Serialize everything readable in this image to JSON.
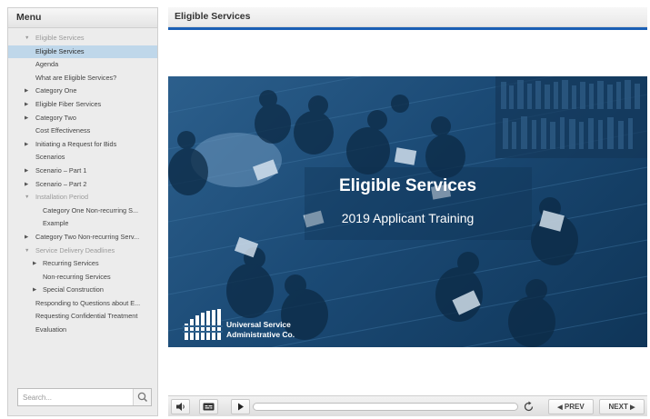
{
  "menu": {
    "header": "Menu",
    "items": [
      {
        "label": "Eligible Services",
        "indent": 1,
        "arrow": "down",
        "dim": true
      },
      {
        "label": "Eligible Services",
        "indent": 2,
        "selected": true
      },
      {
        "label": "Agenda",
        "indent": 2
      },
      {
        "label": "What are Eligible Services?",
        "indent": 2
      },
      {
        "label": "Category One",
        "indent": 1,
        "arrow": "right"
      },
      {
        "label": "Eligible Fiber Services",
        "indent": 1,
        "arrow": "right"
      },
      {
        "label": "Category Two",
        "indent": 1,
        "arrow": "right"
      },
      {
        "label": "Cost Effectiveness",
        "indent": 2
      },
      {
        "label": "Initiating a Request for Bids",
        "indent": 1,
        "arrow": "right"
      },
      {
        "label": "Scenarios",
        "indent": 2
      },
      {
        "label": "Scenario – Part 1",
        "indent": 1,
        "arrow": "right"
      },
      {
        "label": "Scenario – Part 2",
        "indent": 1,
        "arrow": "right"
      },
      {
        "label": "Installation Period",
        "indent": 1,
        "arrow": "down",
        "dim": true
      },
      {
        "label": "Category One Non-recurring S...",
        "indent": 3
      },
      {
        "label": "Example",
        "indent": 3
      },
      {
        "label": "Category Two Non-recurring Serv...",
        "indent": 1,
        "arrow": "right"
      },
      {
        "label": "Service Delivery Deadlines",
        "indent": 1,
        "arrow": "down",
        "dim": true
      },
      {
        "label": "Recurring Services",
        "indent": 3,
        "arrow": "right"
      },
      {
        "label": "Non-recurring Services",
        "indent": 3
      },
      {
        "label": "Special Construction",
        "indent": 3,
        "arrow": "right"
      },
      {
        "label": "Responding to Questions about E...",
        "indent": 2
      },
      {
        "label": "Requesting Confidential Treatment",
        "indent": 2
      },
      {
        "label": "Evaluation",
        "indent": 2
      }
    ]
  },
  "search": {
    "placeholder": "Search..."
  },
  "player": {
    "title": "Eligible Services",
    "slide": {
      "title": "Eligible Services",
      "subtitle": "2019 Applicant Training",
      "brand_line1": "Universal Service",
      "brand_line2": "Administrative Co."
    }
  },
  "controls": {
    "prev_label": "PREV",
    "next_label": "NEXT"
  },
  "icons": [
    "volume-icon",
    "captions-icon",
    "play-icon",
    "replay-icon",
    "search-icon",
    "chevron-left-icon",
    "chevron-right-icon",
    "menu-expanded-icon",
    "menu-collapsed-icon"
  ],
  "colors": {
    "accent_rule": "#1a5fb4",
    "selected_bg": "#bfd7ea",
    "slide_blue": "#1b4a75"
  }
}
